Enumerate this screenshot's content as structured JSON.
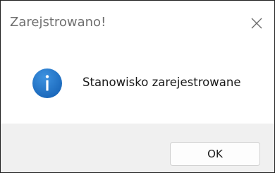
{
  "window": {
    "title": "Zarejstrowano!",
    "close_icon": "close-icon"
  },
  "content": {
    "icon": "info-icon",
    "message": "Stanowisko zarejestrowane"
  },
  "footer": {
    "ok_label": "OK"
  },
  "colors": {
    "icon_blue": "#1e73c8",
    "footer_bg": "#f0f0f0",
    "title_text": "#6f6f6f"
  }
}
